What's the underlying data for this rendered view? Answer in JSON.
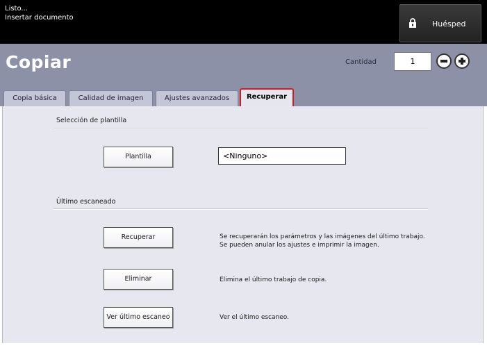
{
  "status": {
    "line1": "Listo...",
    "line2": "Insertar documento"
  },
  "user": {
    "label": "Huésped",
    "icon": "lock-user-icon"
  },
  "header": {
    "title": "Copiar",
    "quantity_label": "Cantidad",
    "quantity_value": "1"
  },
  "tabs": [
    {
      "label": "Copia básica"
    },
    {
      "label": "Calidad de imagen"
    },
    {
      "label": "Ajustes avanzados"
    },
    {
      "label": "Recuperar",
      "active": true
    }
  ],
  "template_section": {
    "title": "Selección de plantilla",
    "button_label": "Plantilla",
    "value": "<Ninguno>"
  },
  "last_scan_section": {
    "title": "Último escaneado",
    "actions": [
      {
        "button_label": "Recuperar",
        "description_line1": "Se recuperarán los parámetros y las imágenes del último trabajo.",
        "description_line2": "Se pueden anular los ajustes e imprimir la imagen."
      },
      {
        "button_label": "Eliminar",
        "description_line1": "Elimina el último trabajo de copia."
      },
      {
        "button_label": "Ver último escaneo",
        "description_line1": "Ver el último escaneo."
      }
    ]
  },
  "colors": {
    "header_bg": "#8d91a8",
    "panel_bg": "#e6e7ef",
    "active_tab_border": "#d01c24",
    "status_bg": "#000000"
  }
}
